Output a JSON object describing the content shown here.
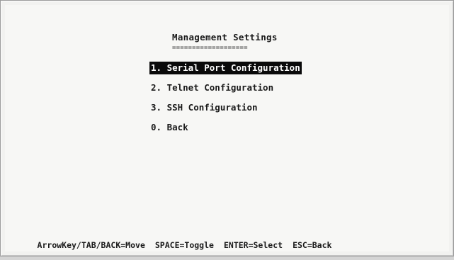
{
  "screen": {
    "title": "Management Settings",
    "title_underline": "===================",
    "menu": [
      {
        "label": "1. Serial Port Configuration",
        "selected": true
      },
      {
        "label": "2. Telnet Configuration",
        "selected": false
      },
      {
        "label": "3. SSH Configuration",
        "selected": false
      },
      {
        "label": "0. Back",
        "selected": false
      }
    ],
    "footer": {
      "move": "ArrowKey/TAB/BACK=Move",
      "toggle": "SPACE=Toggle",
      "select": "ENTER=Select",
      "back": "ESC=Back"
    }
  },
  "colors": {
    "background": "#f7f7f5",
    "text": "#1a1a1a",
    "highlight_bg": "#0a0a0a",
    "highlight_fg": "#ffffff"
  }
}
